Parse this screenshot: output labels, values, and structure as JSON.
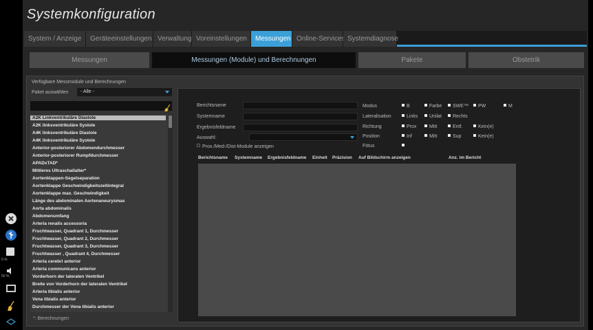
{
  "app": {
    "title": "Systemkonfiguration"
  },
  "left_bar": {
    "items": [
      {
        "icon": "close-circle-icon"
      },
      {
        "icon": "usb-icon"
      },
      {
        "icon": "print-icon",
        "caption": "5 %"
      },
      {
        "icon": "volume-icon",
        "caption": "50 %"
      },
      {
        "icon": "monitor-icon"
      },
      {
        "icon": "broom-icon"
      },
      {
        "icon": "network-icon"
      }
    ]
  },
  "tabs": [
    {
      "label": "System / Anzeige",
      "active": false
    },
    {
      "label": "Geräteeinstellungen",
      "active": false
    },
    {
      "label": "Verwaltung",
      "active": false
    },
    {
      "label": "Voreinstellungen",
      "active": false
    },
    {
      "label": "Messungen",
      "active": true
    },
    {
      "label": "Online-Services",
      "active": false
    },
    {
      "label": "Systemdiagnose",
      "active": false
    }
  ],
  "subtabs": [
    {
      "label": "Messungen",
      "active": false
    },
    {
      "label": "Messungen (Module) und Berechnungen",
      "active": true
    },
    {
      "label": "Pakete",
      "active": false
    },
    {
      "label": "Obstetrik",
      "active": false
    }
  ],
  "left_panel": {
    "heading": "Verfügbare Messmodule und Berechnungen",
    "package_label": "Paket auswählen",
    "package_value": "- Alle -",
    "search_value": "",
    "items": [
      "A2K Linkventrikuläre Diastole",
      "A2K linksventrikuläre Systole",
      "A4K linksventrikuläre Diastole",
      "A4K linksventrikuläre Systole",
      "Anterior-posteriorer Abdomendurchmesser",
      "Anterior-posteriorer Rumpfdurchmesser",
      "APADxTAD*",
      "Mittleres Ultraschallalter*",
      "Aortenklappen-Segelseparation",
      "Aortenklappe Geschwindigkeitszeitintegral",
      "Aortenklappe max. Geschwindigkeit",
      "Länge des abdominalen Aortenaneurysmas",
      "Aorta abdominalis",
      "Abdomenumfang",
      "Arteria renalis accessoria",
      "Fruchtwasser, Quadrant 1, Durchmesser",
      "Fruchtwasser, Quadrant 2, Durchmesser",
      "Fruchtwasser, Quadrant 3, Durchmesser",
      "Fruchtwasser , Quadrant 4, Durchmesser",
      "Arteria cerebri anterior",
      "Arteria communicans anterior",
      "Vorderhorn der lateralen Ventrikel",
      "Breite von Vorderhorn der lateralen Ventrikel",
      "Arteria tibialis anterior",
      "Vena tibialis anterior",
      "Durchmesser der Vena tibialis anterior"
    ],
    "selected_index": 0,
    "footnote": "*: Berechnungen"
  },
  "right_panel": {
    "fields": {
      "report_name_label": "Berichtsname",
      "system_name_label": "Systemname",
      "result_field_label": "Ergebnisfeldname",
      "selection_label": "Auswahl:",
      "checkbox_label": "Prox./Med-/Dist-Module anzeigen",
      "checkbox_checked": false
    },
    "options": {
      "modus": {
        "label": "Modus",
        "values": [
          "B",
          "Farbe",
          "SWE™",
          "PW",
          "M"
        ]
      },
      "lateral": {
        "label": "Lateralisation",
        "values": [
          "Links",
          "Unilat",
          "Rechts"
        ]
      },
      "richtung": {
        "label": "Richtung",
        "values": [
          "Prox",
          "Mitt",
          "Entf.",
          "Kein(e)"
        ]
      },
      "position": {
        "label": "Position",
        "values": [
          "Inf",
          "Mitt",
          "Sup",
          "Kein(e)"
        ]
      },
      "foetus": {
        "label": "Fötus"
      }
    },
    "table_headers": [
      "Berichtsname",
      "Systemname",
      "Ergebnisfeldname",
      "Einheit",
      "Präzision",
      "Auf Bildschirm anzeigen",
      "Anz. im Bericht"
    ]
  },
  "colors": {
    "accent": "#3ba0d8",
    "panel": "#333333",
    "background": "#262626"
  }
}
